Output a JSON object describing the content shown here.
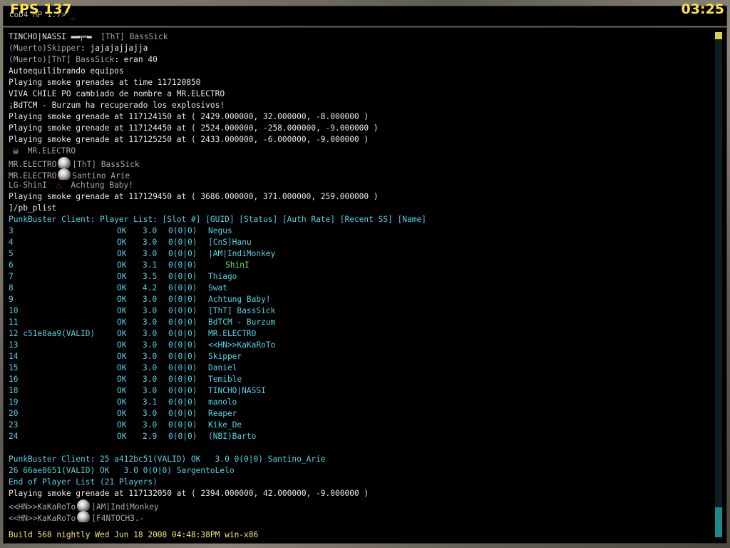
{
  "hud": {
    "fps": "FPS 137",
    "clock": "03:25"
  },
  "input": {
    "prompt": "CoD4 MP 1.7> _"
  },
  "chat": [
    {
      "a": "TINCHO|NASSI",
      "b": "[ThT] BassSick"
    },
    {
      "prefix": "(Muerto)Skipper",
      "msg": ": jajajajjajja"
    },
    {
      "prefix": "(Muerto)[ThT] BassSick",
      "msg": ": eran 40"
    }
  ],
  "lines_white_1": [
    "Autoequilibrando equipos",
    "Playing smoke grenades at time 117120850",
    "VIVA CHILE PO cambiado de nombre a MR.ELECTRO",
    "¡BdTCM - Burzum ha recuperado los explosivos!",
    "Playing smoke grenade at 117124150 at ( 2429.000000, 32.000000, -8.000000 )",
    "Playing smoke grenade at 117124450 at ( 2524.000000, -258.000000, -9.000000 )",
    "Playing smoke grenade at 117125250 at ( 2433.000000, -6.000000, -9.000000 )"
  ],
  "kills": [
    {
      "attacker": "",
      "victim": "MR.ELECTRO",
      "icon": "skull-icon"
    },
    {
      "attacker": "MR.ELECTRO",
      "victim": "[ThT] BassSick",
      "icon": "grenade-icon"
    },
    {
      "attacker": "MR.ELECTRO",
      "victim": "Santino_Arie",
      "icon": "grenade-icon"
    },
    {
      "attacker": "LG-ShinI",
      "victim": "Achtung Baby!",
      "icon": "fire-icon"
    }
  ],
  "line_after_kills": "Playing smoke grenade at 117129450 at ( 3686.000000, 371.000000, 259.000000 )",
  "command": "]/pb_plist",
  "pb_header": "PunkBuster Client: Player List: [Slot #] [GUID] [Status] [Auth Rate] [Recent SS] [Name]",
  "players": [
    {
      "slot": "3",
      "status": "OK",
      "rate": "3.0",
      "ss": "0(0|0)",
      "name": "Negus"
    },
    {
      "slot": "4",
      "status": "OK",
      "rate": "3.0",
      "ss": "0(0|0)",
      "name": "[CnS]Hanu"
    },
    {
      "slot": "5",
      "status": "OK",
      "rate": "3.0",
      "ss": "0(0|0)",
      "name": "|AM|IndiMonkey"
    },
    {
      "slot": "6",
      "status": "OK",
      "rate": "3.1",
      "ss": "0(0|0)",
      "name": "ShinI",
      "green": true
    },
    {
      "slot": "7",
      "status": "OK",
      "rate": "3.5",
      "ss": "0(0|0)",
      "name": "Thiago"
    },
    {
      "slot": "8",
      "status": "OK",
      "rate": "4.2",
      "ss": "0(0|0)",
      "name": "Swat"
    },
    {
      "slot": "9",
      "status": "OK",
      "rate": "3.0",
      "ss": "0(0|0)",
      "name": "Achtung Baby!"
    },
    {
      "slot": "10",
      "status": "OK",
      "rate": "3.0",
      "ss": "0(0|0)",
      "name": "[ThT] BassSick"
    },
    {
      "slot": "11",
      "status": "OK",
      "rate": "3.0",
      "ss": "0(0|0)",
      "name": "BdTCM - Burzum"
    },
    {
      "slot": "12 c51e8aa9(VALID)",
      "status": "OK",
      "rate": "3.0",
      "ss": "0(0|0)",
      "name": "MR.ELECTRO"
    },
    {
      "slot": "13",
      "status": "OK",
      "rate": "3.0",
      "ss": "0(0|0)",
      "name": "<<HN>>KaKaRoTo"
    },
    {
      "slot": "14",
      "status": "OK",
      "rate": "3.0",
      "ss": "0(0|0)",
      "name": "Skipper"
    },
    {
      "slot": "15",
      "status": "OK",
      "rate": "3.0",
      "ss": "0(0|0)",
      "name": "Daniel"
    },
    {
      "slot": "16",
      "status": "OK",
      "rate": "3.0",
      "ss": "0(0|0)",
      "name": "Temible"
    },
    {
      "slot": "18",
      "status": "OK",
      "rate": "3.0",
      "ss": "0(0|0)",
      "name": "TINCHO|NASSI"
    },
    {
      "slot": "19",
      "status": "OK",
      "rate": "3.1",
      "ss": "0(0|0)",
      "name": "manolo"
    },
    {
      "slot": "20",
      "status": "OK",
      "rate": "3.0",
      "ss": "0(0|0)",
      "name": "Reaper"
    },
    {
      "slot": "23",
      "status": "OK",
      "rate": "3.0",
      "ss": "0(0|0)",
      "name": "Kike_De"
    },
    {
      "slot": "24",
      "status": "OK",
      "rate": "2.9",
      "ss": "0(0|0)",
      "name": "(NBI)Barto"
    }
  ],
  "pb_tail": [
    "PunkBuster Client: 25 a412bc51(VALID) OK   3.0 0(0|0) Santino_Arie",
    "26 66ae8651(VALID) OK   3.0 0(0|0) SargentoLelo",
    "End of Player List (21 Players)"
  ],
  "line_end": "Playing smoke grenade at 117132050 at ( 2394.000000, 42.000000, -9.000000 )",
  "kills2": [
    {
      "attacker": "<<HN>>KaKaRoTo",
      "victim": "|AM|IndiMonkey"
    },
    {
      "attacker": "<<HN>>KaKaRoTo",
      "victim": "[F4NTOCH3.-"
    }
  ],
  "build": "Build 568 nightly Wed Jun 18 2008 04:48:38PM win-x86"
}
